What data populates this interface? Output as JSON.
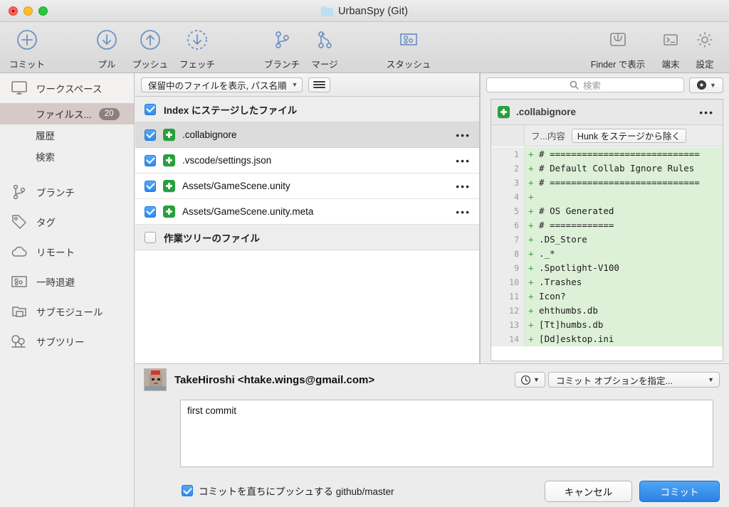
{
  "window": {
    "title": "UrbanSpy (Git)",
    "folder_icon": "folder-icon",
    "controls": [
      "close",
      "minimize",
      "zoom"
    ]
  },
  "toolbar": {
    "items": [
      {
        "label": "コミット",
        "icon": "plus-circle-icon"
      },
      {
        "label": "プル",
        "icon": "arrow-down-circle-icon"
      },
      {
        "label": "プッシュ",
        "icon": "arrow-up-circle-icon"
      },
      {
        "label": "フェッチ",
        "icon": "arrow-down-dashed-circle-icon"
      },
      {
        "label": "ブランチ",
        "icon": "branch-icon"
      },
      {
        "label": "マージ",
        "icon": "merge-icon"
      },
      {
        "label": "スタッシュ",
        "icon": "stash-icon"
      },
      {
        "label": "Finder で表示",
        "icon": "finder-icon"
      },
      {
        "label": "端末",
        "icon": "terminal-icon"
      },
      {
        "label": "設定",
        "icon": "gear-icon"
      }
    ]
  },
  "sidebar": {
    "items": [
      {
        "label": "ワークスペース",
        "icon": "monitor-icon",
        "type": "group"
      },
      {
        "label": "ファイルス...",
        "badge": "20",
        "type": "sub",
        "selected": true
      },
      {
        "label": "履歴",
        "type": "sub",
        "selected": false
      },
      {
        "label": "検索",
        "type": "sub",
        "selected": false
      },
      {
        "label": "ブランチ",
        "icon": "branch-icon",
        "type": "group"
      },
      {
        "label": "タグ",
        "icon": "tag-icon",
        "type": "group"
      },
      {
        "label": "リモート",
        "icon": "cloud-icon",
        "type": "group"
      },
      {
        "label": "一時退避",
        "icon": "stash-icon",
        "type": "group"
      },
      {
        "label": "サブモジュール",
        "icon": "submodule-icon",
        "type": "group"
      },
      {
        "label": "サブツリー",
        "icon": "subtree-icon",
        "type": "group"
      }
    ]
  },
  "file_list": {
    "filter_label": "保留中のファイルを表示, パス名順",
    "view_toggle_icon": "list-view-icon",
    "staged_group": {
      "label": "Index にステージしたファイル",
      "checked": true
    },
    "staged_files": [
      {
        "name": ".collabignore",
        "status": "added",
        "checked": true,
        "selected": true
      },
      {
        "name": ".vscode/settings.json",
        "status": "added",
        "checked": true,
        "selected": false
      },
      {
        "name": "Assets/GameScene.unity",
        "status": "added",
        "checked": true,
        "selected": false
      },
      {
        "name": "Assets/GameScene.unity.meta",
        "status": "added",
        "checked": true,
        "selected": false
      }
    ],
    "unstaged_group": {
      "label": "作業ツリーのファイル",
      "checked": false
    },
    "row_menu_icon": "ellipsis-icon"
  },
  "diff_panel": {
    "search_placeholder": "検索",
    "search_icon": "search-icon",
    "settings_icon": "gear-icon",
    "settings_chevron": "chevron-down-icon",
    "file_name": ".collabignore",
    "file_status": "added",
    "file_menu_icon": "ellipsis-icon",
    "column_label": "フ...内容",
    "unstage_hunk_label": "Hunk をステージから除く",
    "lines": [
      {
        "n": "1",
        "sign": "+",
        "text": "# ============================"
      },
      {
        "n": "2",
        "sign": "+",
        "text": "# Default Collab Ignore Rules"
      },
      {
        "n": "3",
        "sign": "+",
        "text": "# ============================"
      },
      {
        "n": "4",
        "sign": "+",
        "text": ""
      },
      {
        "n": "5",
        "sign": "+",
        "text": "# OS Generated"
      },
      {
        "n": "6",
        "sign": "+",
        "text": "# ============"
      },
      {
        "n": "7",
        "sign": "+",
        "text": ".DS_Store"
      },
      {
        "n": "8",
        "sign": "+",
        "text": "._*"
      },
      {
        "n": "9",
        "sign": "+",
        "text": ".Spotlight-V100"
      },
      {
        "n": "10",
        "sign": "+",
        "text": ".Trashes"
      },
      {
        "n": "11",
        "sign": "+",
        "text": "Icon?"
      },
      {
        "n": "12",
        "sign": "+",
        "text": "ehthumbs.db"
      },
      {
        "n": "13",
        "sign": "+",
        "text": "[Tt]humbs.db"
      },
      {
        "n": "14",
        "sign": "+",
        "text": "[Dd]esktop.ini"
      }
    ]
  },
  "commit_panel": {
    "author": "TakeHiroshi <htake.wings@gmail.com>",
    "avatar_icon": "user-avatar",
    "history_icon": "clock-icon",
    "history_chevron": "chevron-down-icon",
    "options_label": "コミット オプションを指定...",
    "options_chevron": "chevron-down-icon",
    "message": "first commit",
    "message_placeholder": "",
    "push_checkbox": {
      "label": "コミットを直ちにプッシュする github/master",
      "checked": true
    },
    "cancel_label": "キャンセル",
    "commit_label": "コミット"
  },
  "colors": {
    "accent_blue": "#2a82e4",
    "added_green": "#27a13c",
    "diff_bg": "#ddf0d8",
    "selection": "#d6c9c7",
    "toolbar_icon": "#6f93c4"
  }
}
